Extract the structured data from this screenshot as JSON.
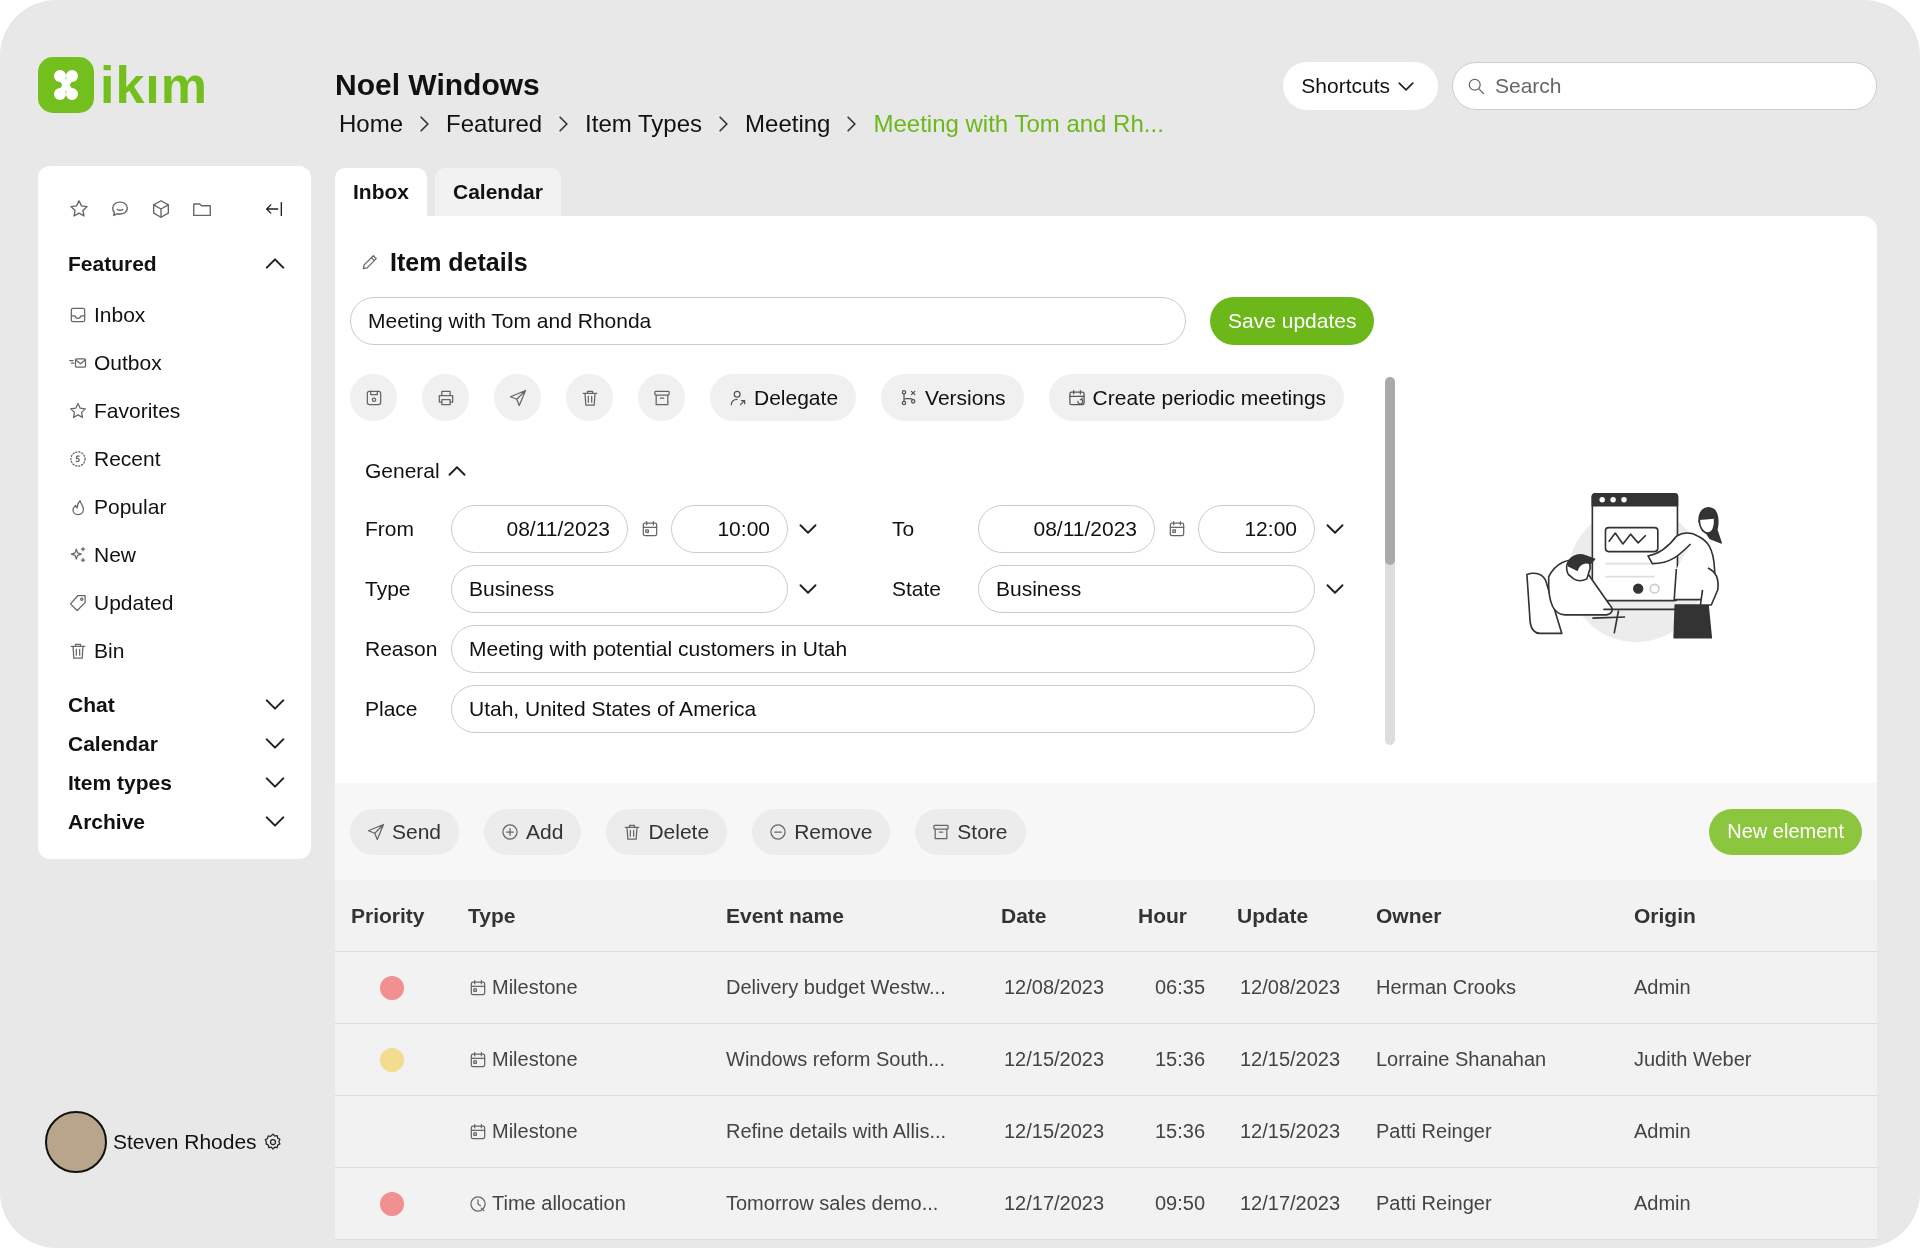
{
  "logo": {
    "text": "ikım"
  },
  "sidebar": {
    "sections": [
      {
        "label": "Featured",
        "expanded": true,
        "items": [
          {
            "label": "Inbox"
          },
          {
            "label": "Outbox"
          },
          {
            "label": "Favorites"
          },
          {
            "label": "Recent"
          },
          {
            "label": "Popular"
          },
          {
            "label": "New"
          },
          {
            "label": "Updated"
          },
          {
            "label": "Bin"
          }
        ]
      },
      {
        "label": "Chat",
        "expanded": false
      },
      {
        "label": "Calendar",
        "expanded": false
      },
      {
        "label": "Item types",
        "expanded": false
      },
      {
        "label": "Archive",
        "expanded": false
      }
    ]
  },
  "user": {
    "name": "Steven Rhodes"
  },
  "header": {
    "title": "Noel Windows",
    "shortcuts": "Shortcuts",
    "search": {
      "placeholder": "Search"
    },
    "breadcrumb": [
      {
        "label": "Home",
        "current": false
      },
      {
        "label": "Featured",
        "current": false
      },
      {
        "label": "Item Types",
        "current": false
      },
      {
        "label": "Meeting",
        "current": false
      },
      {
        "label": "Meeting with Tom and Rh...",
        "current": true
      }
    ]
  },
  "tabs": [
    {
      "label": "Inbox",
      "selected": true
    },
    {
      "label": "Calendar",
      "selected": false
    }
  ],
  "details": {
    "heading": "Item details",
    "title_value": "Meeting with Tom and Rhonda",
    "save": "Save updates",
    "actions": [
      {
        "label": "Delegate"
      },
      {
        "label": "Versions"
      },
      {
        "label": "Create periodic meetings"
      }
    ],
    "section": {
      "label": "General",
      "expanded": true
    },
    "from": {
      "label": "From",
      "date": "08/11/2023",
      "time": "10:00"
    },
    "to": {
      "label": "To",
      "date": "08/11/2023",
      "time": "12:00"
    },
    "type": {
      "label": "Type",
      "value": "Business"
    },
    "state": {
      "label": "State",
      "value": "Business"
    },
    "reason": {
      "label": "Reason",
      "value": "Meeting with potential customers in Utah"
    },
    "place": {
      "label": "Place",
      "value": "Utah, United States of America"
    }
  },
  "toolbar": {
    "actions": [
      {
        "label": "Send"
      },
      {
        "label": "Add"
      },
      {
        "label": "Delete"
      },
      {
        "label": "Remove"
      },
      {
        "label": "Store"
      }
    ],
    "primary": "New element"
  },
  "table": {
    "columns": [
      "Priority",
      "Type",
      "Event name",
      "Date",
      "Hour",
      "Update",
      "Owner",
      "Origin"
    ],
    "rows": [
      {
        "color": "#f09090",
        "kind": "milestone",
        "type": "Milestone",
        "event": "Delivery budget Westw...",
        "date": "12/08/2023",
        "hour": "06:35",
        "update": "12/08/2023",
        "owner": "Herman Crooks",
        "origin": "Admin"
      },
      {
        "color": "#f2dc8e",
        "kind": "milestone",
        "type": "Milestone",
        "event": "Windows reform South...",
        "date": "12/15/2023",
        "hour": "15:36",
        "update": "12/15/2023",
        "owner": "Lorraine Shanahan",
        "origin": "Judith Weber"
      },
      {
        "kind": "milestone",
        "type": "Milestone",
        "event": "Refine details with Allis...",
        "date": "12/15/2023",
        "hour": "15:36",
        "update": "12/15/2023",
        "owner": "Patti Reinger",
        "origin": "Admin"
      },
      {
        "color": "#f09090",
        "kind": "time",
        "type": "Time allocation",
        "event": "Tomorrow sales demo...",
        "date": "12/17/2023",
        "hour": "09:50",
        "update": "12/17/2023",
        "owner": "Patti Reinger",
        "origin": "Admin"
      }
    ]
  }
}
